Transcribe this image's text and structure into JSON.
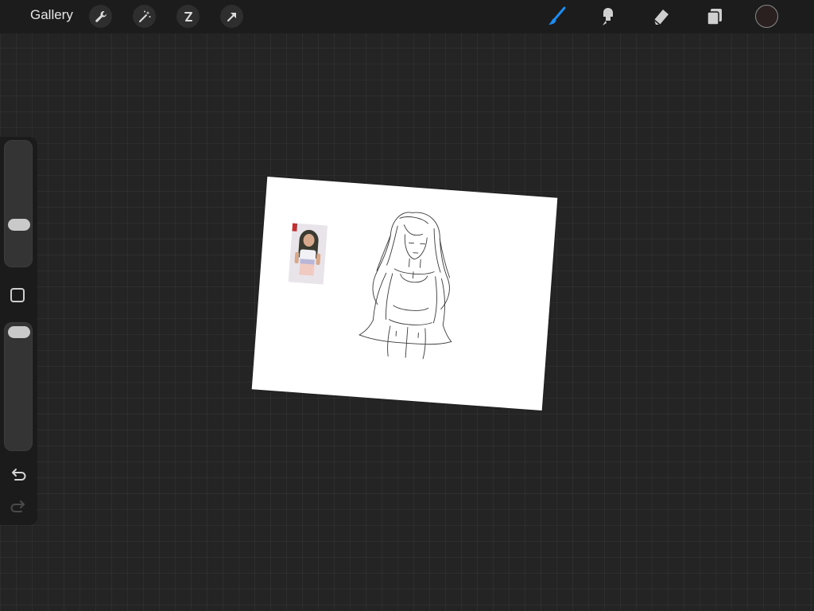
{
  "topbar": {
    "gallery_label": "Gallery",
    "left_tools": [
      "wrench-icon",
      "magic-wand-icon",
      "selection-icon",
      "transform-arrow-icon"
    ],
    "right_tools": [
      "brush-icon",
      "smudge-icon",
      "eraser-icon",
      "layers-icon"
    ],
    "active_tool": "brush-icon",
    "accent_color": "#1f8cf0",
    "current_color": "#2a2020"
  },
  "sidebar": {
    "brush_size_level": 0.2,
    "opacity_level": 1.0,
    "icons": [
      "modify-square-icon",
      "undo-icon",
      "redo-icon"
    ]
  },
  "canvas": {
    "background": "#ffffff",
    "contents": [
      "reference-photo",
      "line-art-sketch"
    ]
  }
}
